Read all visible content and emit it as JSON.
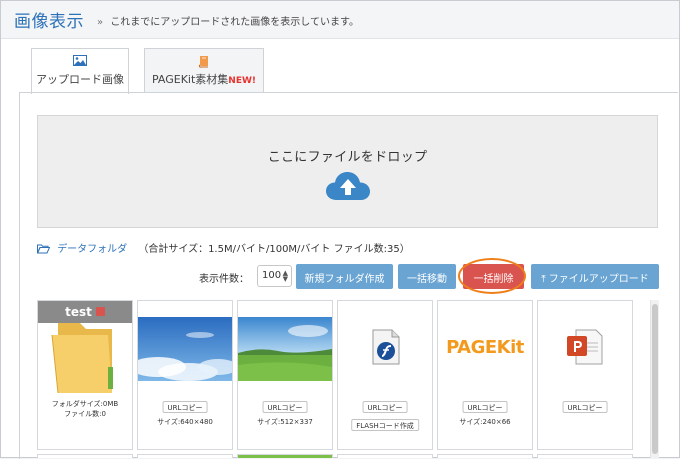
{
  "header": {
    "title": "画像表示",
    "breadcrumb_sep": "»",
    "breadcrumb_text": "これまでにアップロードされた画像を表示しています。"
  },
  "tabs": [
    {
      "label": "アップロード画像",
      "icon": "image-icon",
      "active": true
    },
    {
      "label": "PAGEKit素材集",
      "badge": "NEW!",
      "icon": "book-icon",
      "active": false
    }
  ],
  "dropzone": {
    "text": "ここにファイルをドロップ",
    "icon": "cloud-upload-icon"
  },
  "folder_info": {
    "name": "データフォルダ",
    "summary": "（合計サイズ：1.5M/バイト/100M/バイト ファイル数:35）"
  },
  "toolbar": {
    "count_label": "表示件数：",
    "count_value": "100",
    "new_folder_label": "新規フォルダ作成",
    "move_label": "一括移動",
    "delete_label": "一括削除",
    "upload_label": "ファイルアップロード"
  },
  "cards": [
    {
      "type": "folder",
      "name": "test",
      "folder_size": "フォルダサイズ:0MB",
      "file_count": "ファイル数:0"
    },
    {
      "type": "image",
      "thumb": "sky",
      "url_button": "URLコピー",
      "size": "サイズ:640×480"
    },
    {
      "type": "image",
      "thumb": "field",
      "url_button": "URLコピー",
      "size": "サイズ:512×337"
    },
    {
      "type": "flash",
      "thumb": "flash-file-icon",
      "url_button": "URLコピー",
      "extra_button": "FLASHコード作成"
    },
    {
      "type": "image",
      "thumb": "pagekit-logo",
      "logo_text": "PAGEKit",
      "url_button": "URLコピー",
      "size": "サイズ:240×66"
    },
    {
      "type": "ppt",
      "thumb": "powerpoint-file-icon",
      "url_button": "URLコピー"
    }
  ],
  "colors": {
    "accent": "#2d72b8",
    "button": "#69a4d3",
    "danger": "#d9534f",
    "highlight": "#ef7f1a",
    "new_badge": "#e8322e"
  }
}
